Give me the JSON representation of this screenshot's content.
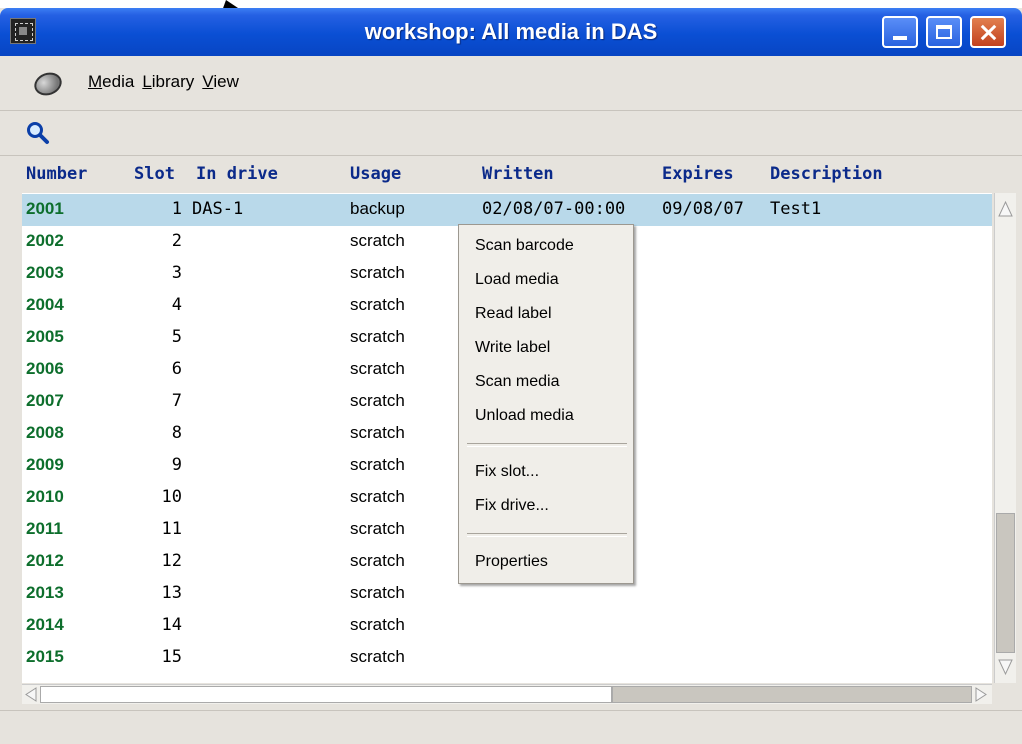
{
  "window": {
    "title": "workshop: All media in DAS"
  },
  "menubar": {
    "items": [
      {
        "accel": "M",
        "rest": "edia"
      },
      {
        "accel": "L",
        "rest": "ibrary"
      },
      {
        "accel": "V",
        "rest": "iew"
      }
    ]
  },
  "toolbar": {
    "search_icon": "search-icon"
  },
  "list": {
    "columns": {
      "number": "Number",
      "slot": "Slot",
      "in_drive": "In drive",
      "usage": "Usage",
      "written": "Written",
      "expires": "Expires",
      "description": "Description"
    },
    "rows": [
      {
        "number": "2001",
        "slot": "1",
        "in_drive": "DAS-1",
        "usage": "backup",
        "written": "02/08/07-00:00",
        "expires": "09/08/07",
        "description": "Test1"
      },
      {
        "number": "2002",
        "slot": "2",
        "in_drive": "",
        "usage": "scratch",
        "written": "",
        "expires": "",
        "description": ""
      },
      {
        "number": "2003",
        "slot": "3",
        "in_drive": "",
        "usage": "scratch",
        "written": "",
        "expires": "",
        "description": ""
      },
      {
        "number": "2004",
        "slot": "4",
        "in_drive": "",
        "usage": "scratch",
        "written": "",
        "expires": "",
        "description": ""
      },
      {
        "number": "2005",
        "slot": "5",
        "in_drive": "",
        "usage": "scratch",
        "written": "",
        "expires": "",
        "description": ""
      },
      {
        "number": "2006",
        "slot": "6",
        "in_drive": "",
        "usage": "scratch",
        "written": "",
        "expires": "",
        "description": ""
      },
      {
        "number": "2007",
        "slot": "7",
        "in_drive": "",
        "usage": "scratch",
        "written": "",
        "expires": "",
        "description": ""
      },
      {
        "number": "2008",
        "slot": "8",
        "in_drive": "",
        "usage": "scratch",
        "written": "",
        "expires": "",
        "description": ""
      },
      {
        "number": "2009",
        "slot": "9",
        "in_drive": "",
        "usage": "scratch",
        "written": "",
        "expires": "",
        "description": ""
      },
      {
        "number": "2010",
        "slot": "10",
        "in_drive": "",
        "usage": "scratch",
        "written": "",
        "expires": "",
        "description": ""
      },
      {
        "number": "2011",
        "slot": "11",
        "in_drive": "",
        "usage": "scratch",
        "written": "",
        "expires": "",
        "description": ""
      },
      {
        "number": "2012",
        "slot": "12",
        "in_drive": "",
        "usage": "scratch",
        "written": "",
        "expires": "",
        "description": ""
      },
      {
        "number": "2013",
        "slot": "13",
        "in_drive": "",
        "usage": "scratch",
        "written": "",
        "expires": "",
        "description": ""
      },
      {
        "number": "2014",
        "slot": "14",
        "in_drive": "",
        "usage": "scratch",
        "written": "",
        "expires": "",
        "description": ""
      },
      {
        "number": "2015",
        "slot": "15",
        "in_drive": "",
        "usage": "scratch",
        "written": "",
        "expires": "",
        "description": ""
      }
    ]
  },
  "context_menu": {
    "group1": [
      "Scan barcode",
      "Load media",
      "Read label",
      "Write label",
      "Scan media",
      "Unload media"
    ],
    "group2": [
      "Fix slot...",
      "Fix drive..."
    ],
    "group3": [
      "Properties"
    ]
  },
  "colors": {
    "titlebar": "#0a4fd4",
    "header_text": "#0b2a8a",
    "number_text": "#0d6e2c",
    "selected_row": "#b9d9ea"
  }
}
